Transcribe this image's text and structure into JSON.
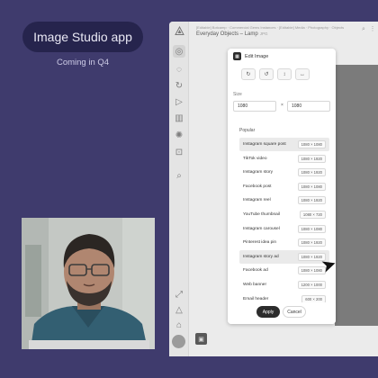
{
  "hero": {
    "title": "Image Studio app",
    "subtitle": "Coming in Q4"
  },
  "app": {
    "breadcrumb": "[Editable] Botcamp · Commercial Gems Instances · [Editable] Media · Photography · Objects",
    "doc_title": "Everyday Objects – Lamp",
    "doc_type": "JPG",
    "rail_icons": [
      "logo-icon",
      "globe-icon",
      "chat-icon",
      "refresh-icon",
      "play-icon",
      "chart-icon",
      "settings-icon",
      "camera-icon",
      "search-icon"
    ]
  },
  "modal": {
    "title": "Edit Image",
    "tools": [
      {
        "name": "rotate-right-icon",
        "glyph": "↻"
      },
      {
        "name": "rotate-left-icon",
        "glyph": "↺"
      },
      {
        "name": "flip-vertical-icon",
        "glyph": "↕"
      },
      {
        "name": "flip-horizontal-icon",
        "glyph": "↔"
      }
    ],
    "size_label": "Size",
    "width_value": "1080",
    "height_value": "1080",
    "popular_label": "Popular",
    "presets": [
      {
        "label": "Instagram square post",
        "dim": "1080 × 1080",
        "selected": true
      },
      {
        "label": "TikTok video",
        "dim": "1080 × 1920",
        "selected": false
      },
      {
        "label": "Instagram story",
        "dim": "1080 × 1920",
        "selected": false
      },
      {
        "label": "Facebook post",
        "dim": "1080 × 1080",
        "selected": false
      },
      {
        "label": "Instagram reel",
        "dim": "1080 × 1920",
        "selected": false
      },
      {
        "label": "YouTube thumbnail",
        "dim": "1080 × 720",
        "selected": false
      },
      {
        "label": "Instagram carousel",
        "dim": "1080 × 1080",
        "selected": false
      },
      {
        "label": "Pinterest idea pin",
        "dim": "1080 × 1920",
        "selected": false
      },
      {
        "label": "Instagram story ad",
        "dim": "1080 × 1920",
        "selected": true
      },
      {
        "label": "Facebook ad",
        "dim": "1080 × 1080",
        "selected": false
      },
      {
        "label": "Web banner",
        "dim": "1200 × 1000",
        "selected": false
      },
      {
        "label": "Email header",
        "dim": "600 × 200",
        "selected": false
      }
    ],
    "apply_label": "Apply",
    "cancel_label": "Cancel"
  },
  "colors": {
    "background": "#3f3b6d",
    "badge": "#26244d",
    "primary_button": "#2c2c2c"
  }
}
